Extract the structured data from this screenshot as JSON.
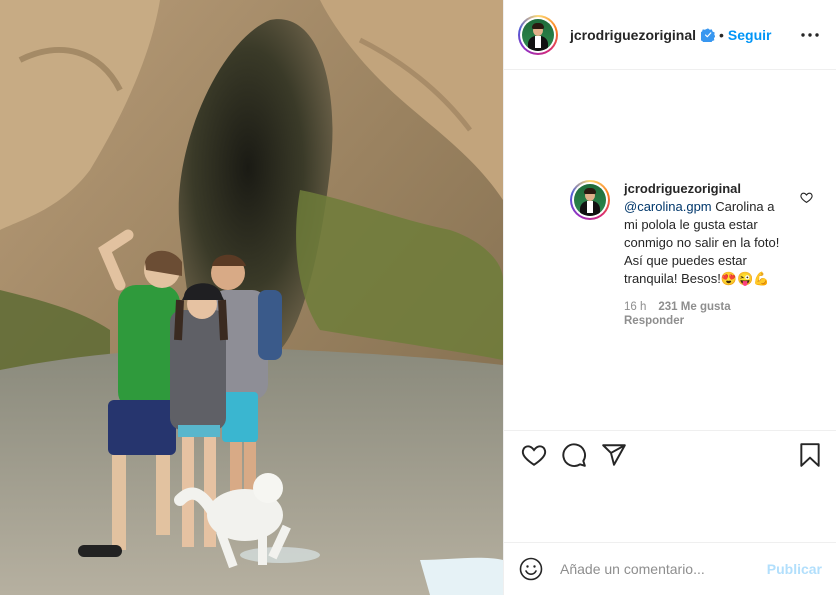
{
  "post": {
    "username": "jcrodriguezoriginal",
    "follow_label": "Seguir",
    "separator": "•"
  },
  "comment": {
    "username": "jcrodriguezoriginal",
    "mention": "@carolina.gpm",
    "text": " Carolina a mi polola le gusta estar conmigo no salir en la foto! Así que puedes estar tranquila! Besos!😍😜💪",
    "time": "16 h",
    "likes": "231 Me gusta",
    "reply_label": "Responder"
  },
  "add_comment": {
    "placeholder": "Añade un comentario...",
    "publish_label": "Publicar"
  },
  "icons": [
    "verified-badge-icon",
    "more-options-icon",
    "heart-icon",
    "comment-icon",
    "share-icon",
    "bookmark-icon",
    "emoji-icon"
  ],
  "colors": {
    "accent": "#0095f6",
    "publish_disabled": "#b2dffc",
    "mention": "#00376b",
    "muted": "#8e8e8e",
    "border": "#efefef"
  }
}
